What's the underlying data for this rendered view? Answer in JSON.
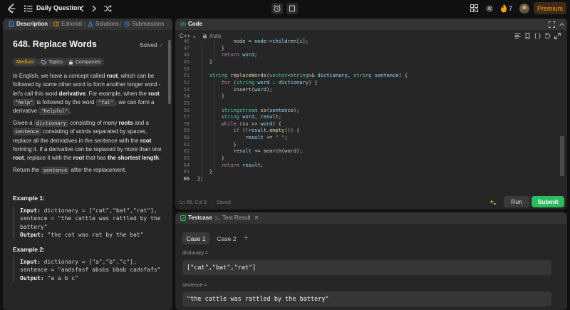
{
  "topbar": {
    "title": "Daily Question",
    "streak": "7",
    "premium": "Premium"
  },
  "left_tabs": {
    "description": "Description",
    "editorial": "Editorial",
    "solutions": "Solutions",
    "submissions": "Submissions"
  },
  "problem": {
    "title": "648. Replace Words",
    "status": "Solved",
    "difficulty": "Medium",
    "topics": "Topics",
    "companies": "Companies",
    "p1_a": "In English, we have a concept called ",
    "p1_root": "root",
    "p1_b": ", which can be followed by some other word to form another longer word - let's call this word ",
    "p1_derivative": "derivative",
    "p1_c": ". For example, when the ",
    "p1_root2": "root",
    "p1_code1": "\"help\"",
    "p1_d": " is followed by the word ",
    "p1_code2": "\"ful\"",
    "p1_e": ", we can form a derivative ",
    "p1_code3": "\"helpful\"",
    "p1_f": ".",
    "p2_a": "Given a ",
    "p2_code1": "dictionary",
    "p2_b": " consisting of many ",
    "p2_roots": "roots",
    "p2_c": " and a ",
    "p2_code2": "sentence",
    "p2_d": " consisting of words separated by spaces, replace all the derivatives in the sentence with the ",
    "p2_root": "root",
    "p2_e": " forming it. If a derivative can be replaced by more than one ",
    "p2_root2": "root",
    "p2_f": ", replace it with the ",
    "p2_root3": "root",
    "p2_g": " that has ",
    "p2_shortest": "the shortest length",
    "p2_h": ".",
    "p3_a": "Return ",
    "p3_the": "the",
    "p3_code": "sentence",
    "p3_b": " after the replacement.",
    "ex1_title": "Example 1:",
    "ex1_input_label": "Input:",
    "ex1_input": " dictionary = [\"cat\",\"bat\",\"rat\"], sentence = \"the cattle was rattled by the battery\"",
    "ex1_output_label": "Output:",
    "ex1_output": " \"the cat was rat by the bat\"",
    "ex2_title": "Example 2:",
    "ex2_input_label": "Input:",
    "ex2_input": " dictionary = [\"a\",\"b\",\"c\"], sentence = \"aadsfasf absbs bbab cadsfafs\"",
    "ex2_output_label": "Output:",
    "ex2_output": " \"a a b c\""
  },
  "code_panel": {
    "tab": "Code",
    "language": "C++",
    "mode": "Auto",
    "status": "Ln 66, Col 3",
    "saved": "Saved",
    "run": "Run",
    "submit": "Submit"
  },
  "code_lines": [
    {
      "n": "46",
      "text": "            node = node->children[i];"
    },
    {
      "n": "47",
      "text": "        }"
    },
    {
      "n": "48",
      "text": "        return word;"
    },
    {
      "n": "49",
      "text": "    }"
    },
    {
      "n": "50",
      "text": ""
    },
    {
      "n": "51",
      "text": "    string replaceWords(vector<string>& dictionary, string sentence) {"
    },
    {
      "n": "52",
      "text": "        for (string word : dictionary) {"
    },
    {
      "n": "53",
      "text": "            insert(word);"
    },
    {
      "n": "54",
      "text": "        }"
    },
    {
      "n": "55",
      "text": ""
    },
    {
      "n": "56",
      "text": "        stringstream ss(sentence);"
    },
    {
      "n": "57",
      "text": "        string word, result;"
    },
    {
      "n": "58",
      "text": "        while (ss >> word) {"
    },
    {
      "n": "59",
      "text": "            if (!result.empty()) {"
    },
    {
      "n": "60",
      "text": "                result += \" \";"
    },
    {
      "n": "61",
      "text": "            }"
    },
    {
      "n": "62",
      "text": "            result += search(word);"
    },
    {
      "n": "63",
      "text": "        }"
    },
    {
      "n": "64",
      "text": "        return result;"
    },
    {
      "n": "65",
      "text": "    }"
    },
    {
      "n": "66",
      "text": "};"
    }
  ],
  "test_panel": {
    "testcase_tab": "Testcase",
    "result_tab": "Test Result",
    "case1": "Case 1",
    "case2": "Case 2",
    "var1_label": "dictionary =",
    "var1_value": "[\"cat\",\"bat\",\"rat\"]",
    "var2_label": "sentence =",
    "var2_value": "\"the cattle was rattled by the battery\""
  },
  "colors": {
    "accent_green": "#2cbb5d",
    "premium": "#ffa116",
    "medium": "#ffb800"
  }
}
